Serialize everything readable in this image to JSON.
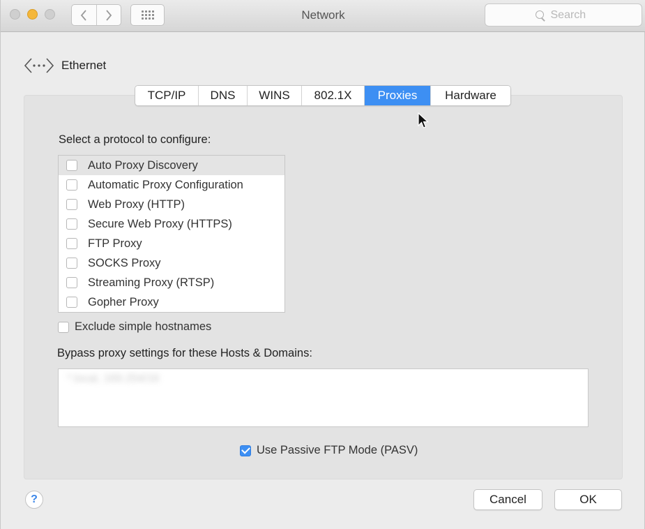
{
  "window": {
    "title": "Network",
    "search_placeholder": "Search",
    "nav": {
      "back_icon": "chevron-left-icon",
      "forward_icon": "chevron-right-icon",
      "grid_icon": "grid-icon"
    }
  },
  "header": {
    "interface_name": "Ethernet",
    "icon": "ethernet-icon"
  },
  "tabs": [
    {
      "label": "TCP/IP",
      "selected": false
    },
    {
      "label": "DNS",
      "selected": false
    },
    {
      "label": "WINS",
      "selected": false
    },
    {
      "label": "802.1X",
      "selected": false
    },
    {
      "label": "Proxies",
      "selected": true
    },
    {
      "label": "Hardware",
      "selected": false
    }
  ],
  "proxies": {
    "protocol_prompt": "Select a protocol to configure:",
    "protocols": [
      {
        "label": "Auto Proxy Discovery",
        "checked": false,
        "highlighted": true
      },
      {
        "label": "Automatic Proxy Configuration",
        "checked": false
      },
      {
        "label": "Web Proxy (HTTP)",
        "checked": false
      },
      {
        "label": "Secure Web Proxy (HTTPS)",
        "checked": false
      },
      {
        "label": "FTP Proxy",
        "checked": false
      },
      {
        "label": "SOCKS Proxy",
        "checked": false
      },
      {
        "label": "Streaming Proxy (RTSP)",
        "checked": false
      },
      {
        "label": "Gopher Proxy",
        "checked": false
      }
    ],
    "exclude_simple_hostnames": {
      "label": "Exclude simple hostnames",
      "checked": false
    },
    "bypass_label": "Bypass proxy settings for these Hosts & Domains:",
    "bypass_value": "*.local, 169.254/16",
    "passive_ftp": {
      "label": "Use Passive FTP Mode (PASV)",
      "checked": true
    }
  },
  "footer": {
    "help_label": "?",
    "cancel_label": "Cancel",
    "ok_label": "OK"
  },
  "colors": {
    "accent": "#3d8ff3",
    "window_bg": "#ececec",
    "panel_bg": "#e3e3e3"
  }
}
